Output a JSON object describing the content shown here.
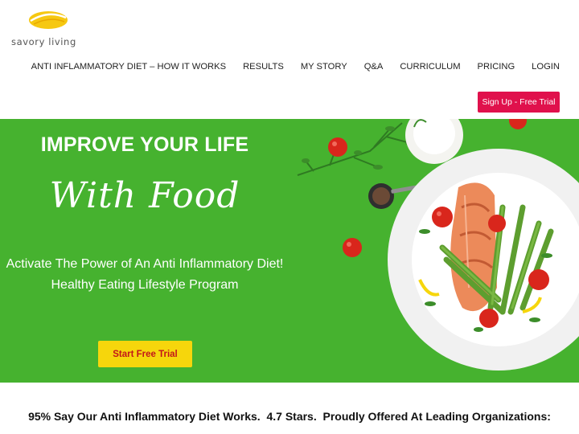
{
  "brand": {
    "logo_text": "savory living",
    "logo_color": "#f6c811"
  },
  "nav": {
    "items": [
      "ANTI INFLAMMATORY DIET – HOW IT WORKS",
      "RESULTS",
      "MY STORY",
      "Q&A",
      "CURRICULUM",
      "PRICING",
      "LOGIN"
    ],
    "signup_label": "Sign Up - Free Trial",
    "signup_color": "#e0114c"
  },
  "hero": {
    "title": "IMPROVE YOUR LIFE",
    "script": "With Food",
    "subtitle_line1": "Activate The Power of An Anti Inflammatory Diet!",
    "subtitle_line2": "Healthy Eating Lifestyle Program",
    "cta_label": "Start Free Trial",
    "background_color": "#46b22f",
    "cta_color": "#f6d60c"
  },
  "tagline": "95% Say Our Anti Inflammatory Diet Works.  4.7 Stars.  Proudly Offered At Leading Organizations:"
}
